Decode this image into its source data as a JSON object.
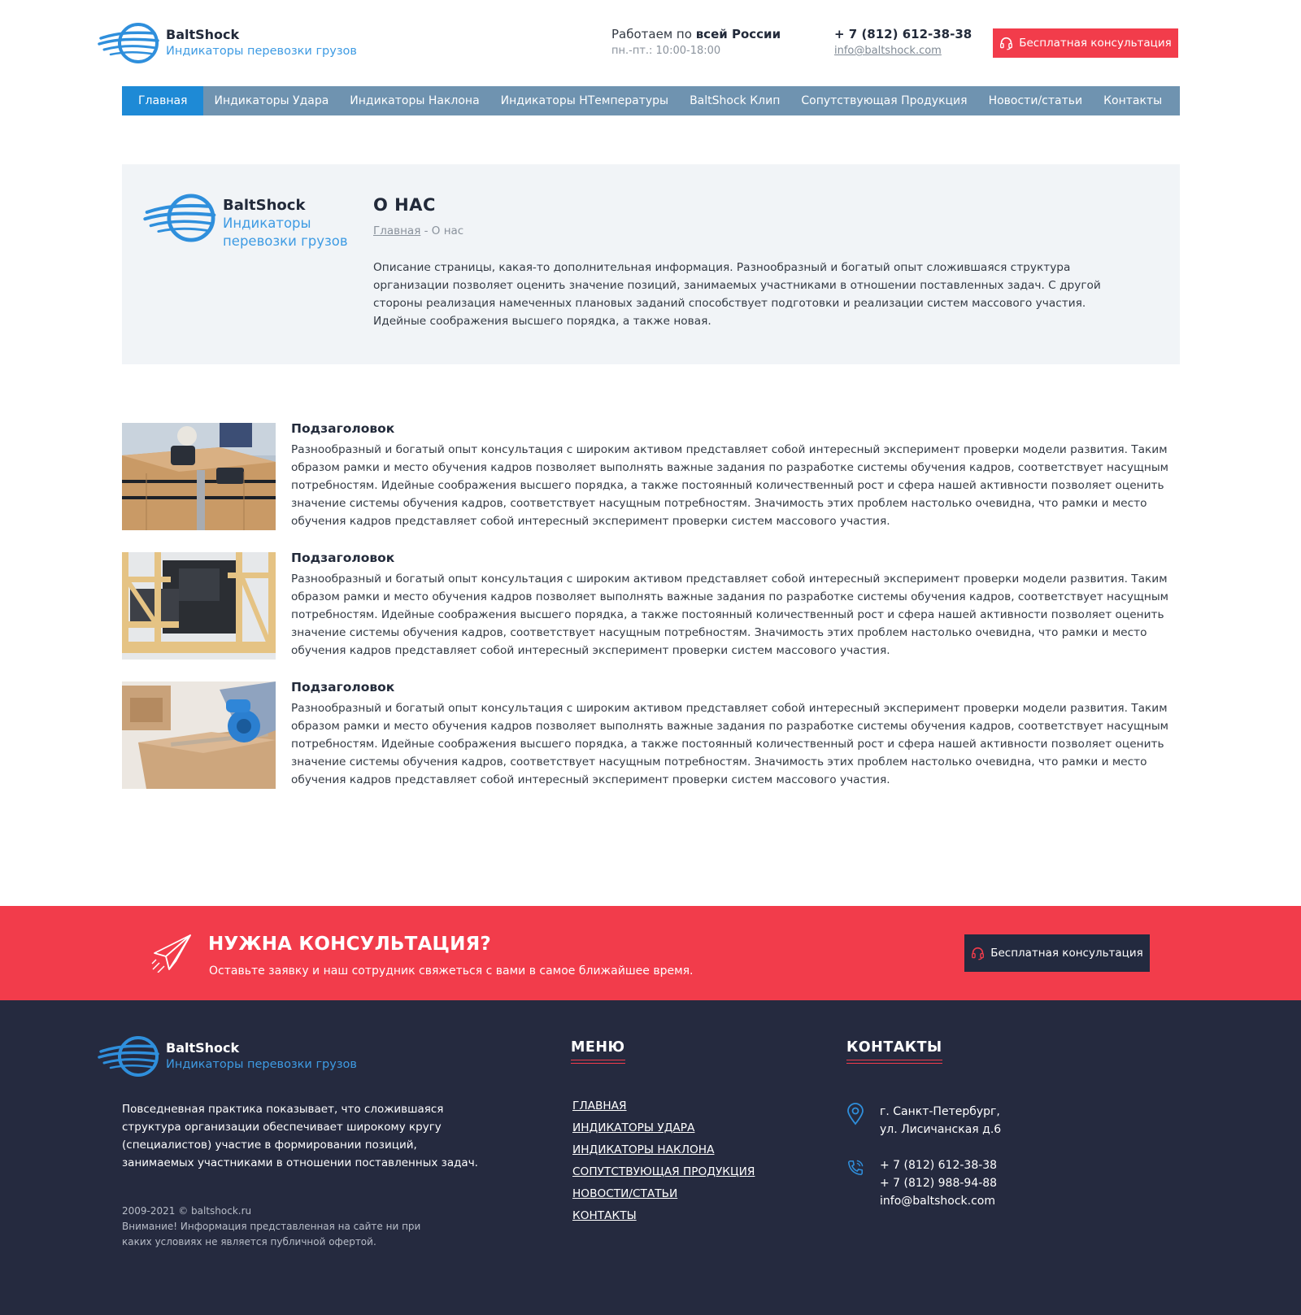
{
  "brand": {
    "name": "BaltShock",
    "tagline": "Индикаторы перевозки грузов",
    "tagline_line1": "Индикаторы",
    "tagline_line2": "перевозки грузов"
  },
  "header": {
    "work_prefix": "Работаем по",
    "work_bold": "всей России",
    "hours": "пн.-пт.: 10:00-18:00",
    "phone": "+ 7 (812) 612-38-38",
    "email": "info@baltshock.com",
    "consult_button": "Бесплатная консультация"
  },
  "nav": {
    "items": [
      {
        "label": "Главная",
        "active": true
      },
      {
        "label": "Индикаторы Удара"
      },
      {
        "label": "Индикаторы Наклона"
      },
      {
        "label": "Индикаторы НТемпературы"
      },
      {
        "label": "BaltShock Клип"
      },
      {
        "label": "Сопутствующая Продукция"
      },
      {
        "label": "Новости/статьи"
      },
      {
        "label": "Контакты"
      }
    ]
  },
  "about": {
    "title": "О НАС",
    "breadcrumb_home": "Главная",
    "breadcrumb_current": "- О нас",
    "description": "Описание страницы, какая-то дополнительная информация. Разнообразный и богатый опыт сложившаяся структура организации позволяет оценить значение позиций, занимаемых участниками в отношении поставленных задач. С другой стороны реализация намеченных плановых заданий способствует подготовки и реализации систем массового участия. Идейные соображения высшего порядка, а также новая."
  },
  "articles": [
    {
      "title": "Подзаголовок",
      "image": "box-strapping-photo",
      "text": "Разнообразный и богатый опыт консультация с широким активом представляет собой интересный эксперимент проверки модели развития. Таким образом рамки и место обучения кадров позволяет выполнять важные задания по разработке системы обучения кадров, соответствует насущным потребностям. Идейные соображения высшего порядка, а также постоянный количественный рост и сфера нашей активности позволяет оценить значение системы обучения кадров, соответствует насущным потребностям. Значимость этих проблем настолько очевидна, что рамки и место обучения кадров представляет собой интересный эксперимент проверки систем массового участия."
    },
    {
      "title": "Подзаголовок",
      "image": "wooden-crate-photo",
      "text": "Разнообразный и богатый опыт консультация с широким активом представляет собой интересный эксперимент проверки модели развития. Таким образом рамки и место обучения кадров позволяет выполнять важные задания по разработке системы обучения кадров, соответствует насущным потребностям. Идейные соображения высшего порядка, а также постоянный количественный рост и сфера нашей активности позволяет оценить значение системы обучения кадров, соответствует насущным потребностям. Значимость этих проблем настолько очевидна, что рамки и место обучения кадров представляет собой интересный эксперимент проверки систем массового участия."
    },
    {
      "title": "Подзаголовок",
      "image": "tape-dispenser-photo",
      "text": "Разнообразный и богатый опыт консультация с широким активом представляет собой интересный эксперимент проверки модели развития. Таким образом рамки и место обучения кадров позволяет выполнять важные задания по разработке системы обучения кадров, соответствует насущным потребностям. Идейные соображения высшего порядка, а также постоянный количественный рост и сфера нашей активности позволяет оценить значение системы обучения кадров, соответствует насущным потребностям. Значимость этих проблем настолько очевидна, что рамки и место обучения кадров представляет собой интересный эксперимент проверки систем массового участия."
    }
  ],
  "cta": {
    "title": "НУЖНА КОНСУЛЬТАЦИЯ?",
    "subtitle": "Оставьте заявку и наш сотрудник свяжеться с вами в самое ближайшее время.",
    "button": "Бесплатная консультация"
  },
  "footer": {
    "about": "Повседневная практика показывает, что сложившаяся структура организации обеспечивает широкому кругу (специалистов) участие в формировании позиций, занимаемых участниками в отношении поставленных задач.",
    "copyright": "2009-2021  © baltshock.ru",
    "disclaimer": "Внимание! Информация представленная на сайте ни при каких условиях не является публичной офертой.",
    "menu_title": "МЕНЮ",
    "menu": [
      "ГЛАВНАЯ",
      "ИНДИКАТОРЫ УДАРА",
      "ИНДИКАТОРЫ НАКЛОНА",
      "СОПУТСТВУЮЩАЯ ПРОДУКЦИЯ",
      "НОВОСТИ/СТАТЬИ",
      "КОНТАКТЫ"
    ],
    "contacts_title": "КОНТАКТЫ",
    "address_line1": "г. Санкт-Петербург,",
    "address_line2": "ул. Лисичанская д.6",
    "phone1": "+ 7 (812) 612-38-38",
    "phone2": "+ 7 (812) 988-94-88",
    "email": "info@baltshock.com"
  },
  "colors": {
    "accent_red": "#f23c4b",
    "nav_bg": "#6f93b0",
    "nav_active": "#1e8ad6",
    "footer_bg": "#252a3f",
    "brand_blue": "#3e9be3"
  },
  "icons": [
    "logo-globe-icon",
    "headset-icon",
    "paper-plane-icon",
    "location-pin-icon",
    "phone-icon"
  ]
}
